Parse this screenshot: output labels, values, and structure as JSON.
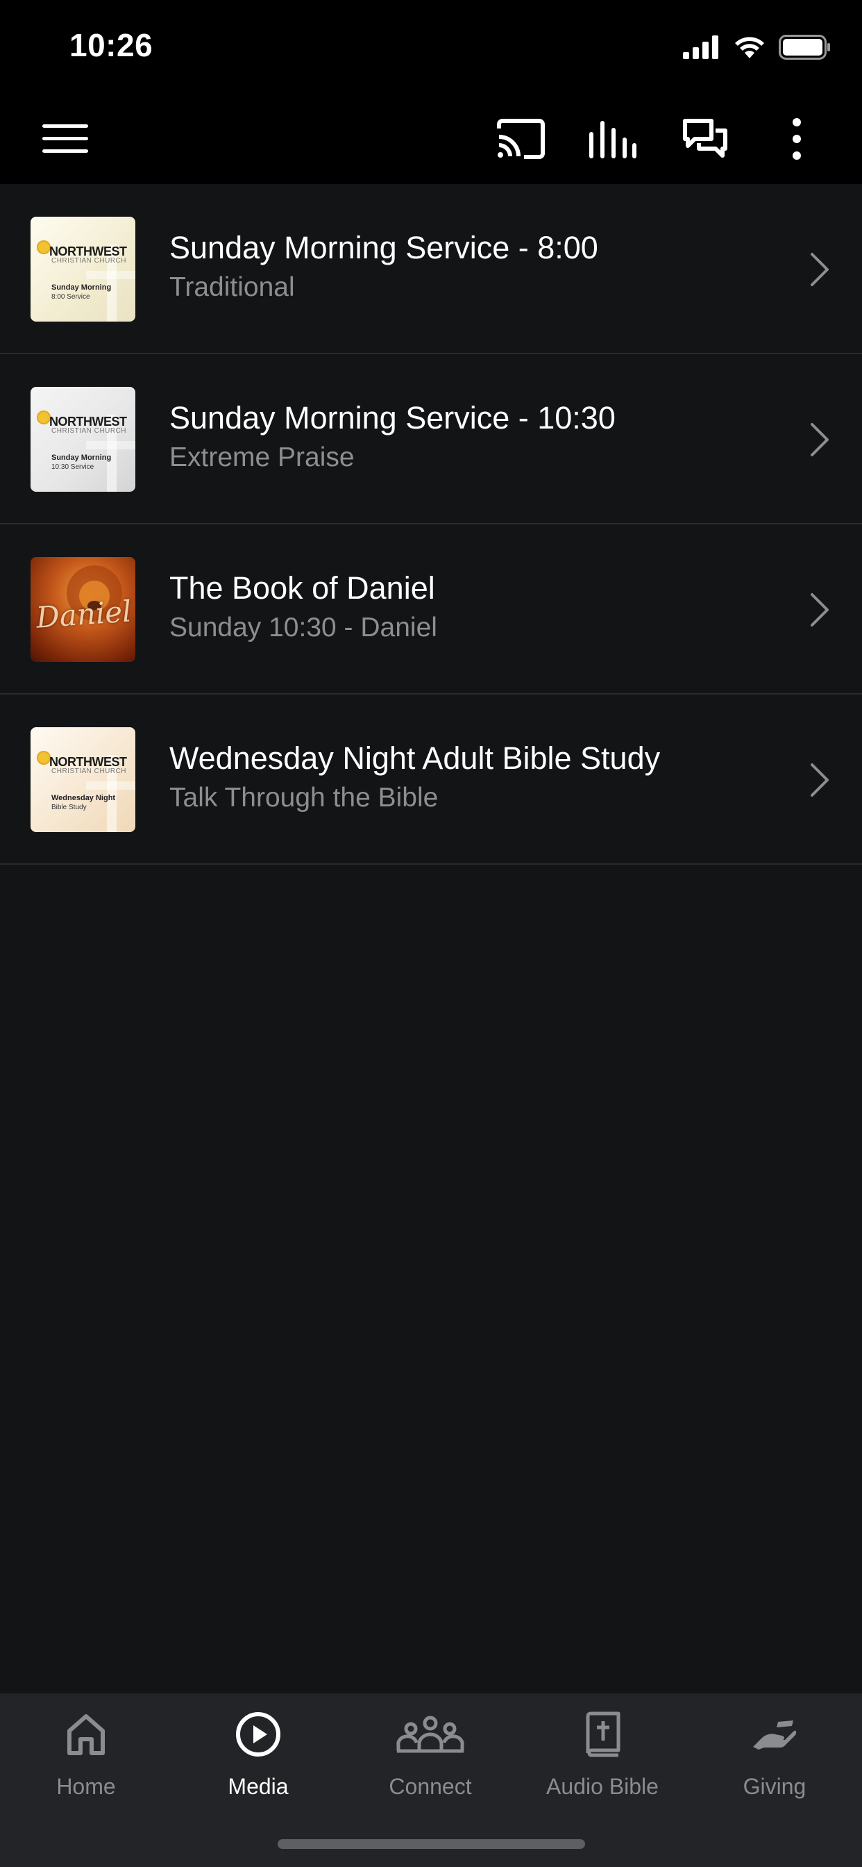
{
  "status_bar": {
    "time": "10:26",
    "icons": [
      "cellular-signal-icon",
      "wifi-icon",
      "battery-icon"
    ]
  },
  "header": {
    "icons": [
      "hamburger-menu-icon",
      "cast-icon",
      "audio-bars-icon",
      "chat-icon",
      "more-vertical-icon"
    ]
  },
  "media_list": [
    {
      "title": "Sunday Morning Service - 8:00",
      "subtitle": "Traditional",
      "thumb": {
        "brand": "NORTHWEST",
        "org": "CHRISTIAN CHURCH",
        "line1": "Sunday Morning",
        "line2": "8:00 Service"
      }
    },
    {
      "title": "Sunday Morning Service - 10:30",
      "subtitle": "Extreme Praise",
      "thumb": {
        "brand": "NORTHWEST",
        "org": "CHRISTIAN CHURCH",
        "line1": "Sunday Morning",
        "line2": "10:30 Service"
      }
    },
    {
      "title": "The Book of Daniel",
      "subtitle": "Sunday 10:30 - Daniel",
      "thumb": {
        "word": "Daniel"
      }
    },
    {
      "title": "Wednesday Night Adult Bible Study",
      "subtitle": "Talk Through the Bible",
      "thumb": {
        "brand": "NORTHWEST",
        "org": "CHRISTIAN CHURCH",
        "line1": "Wednesday Night",
        "line2": "Bible Study"
      }
    }
  ],
  "tabs": [
    {
      "label": "Home",
      "icon": "home-icon",
      "active": false
    },
    {
      "label": "Media",
      "icon": "play-circle-icon",
      "active": true
    },
    {
      "label": "Connect",
      "icon": "people-group-icon",
      "active": false
    },
    {
      "label": "Audio Bible",
      "icon": "bible-icon",
      "active": false
    },
    {
      "label": "Giving",
      "icon": "giving-hand-icon",
      "active": false
    }
  ],
  "colors": {
    "background": "#131416",
    "header_background": "#000000",
    "tab_bar_background": "#232427",
    "subtitle_text": "#8d8e92",
    "inactive_tab": "#8b8c90",
    "active_tab": "#ffffff"
  }
}
